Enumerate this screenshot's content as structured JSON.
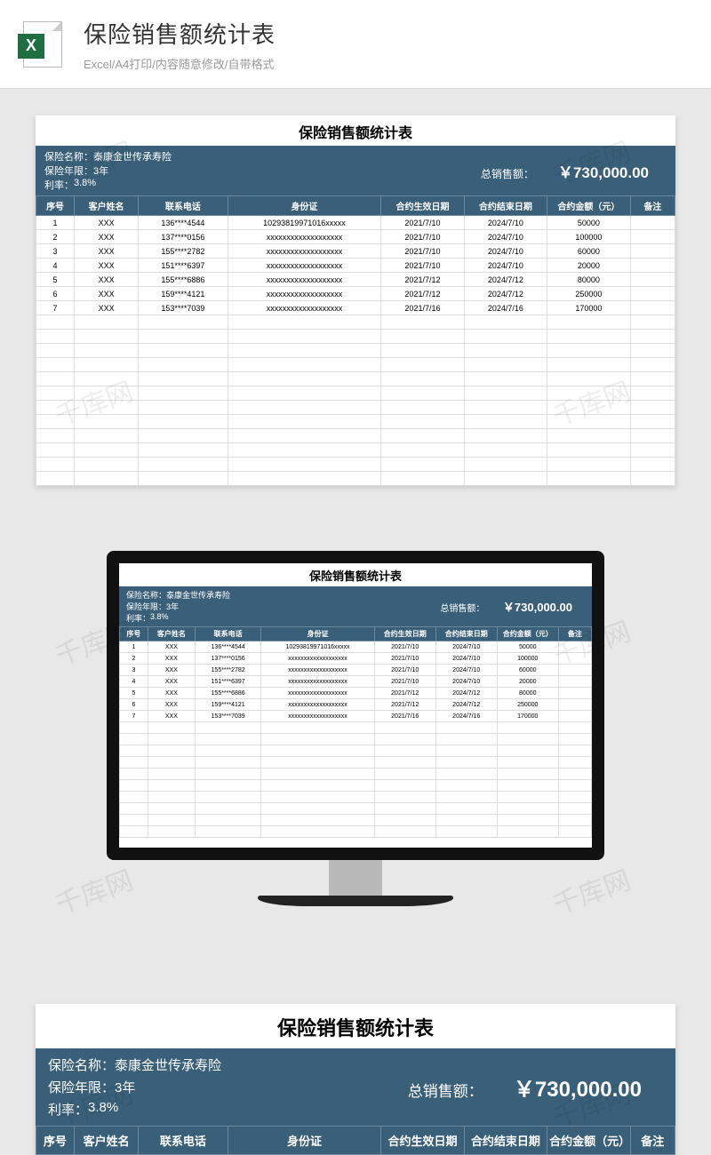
{
  "header": {
    "title": "保险销售额统计表",
    "subtitle": "Excel/A4打印/内容随意修改/自带格式",
    "icon_letter": "X"
  },
  "sheet": {
    "title": "保险销售额统计表",
    "info": {
      "name_label": "保险名称：",
      "name_value": "泰康金世传承寿险",
      "term_label": "保险年限：",
      "term_value": "3年",
      "rate_label": "利率：",
      "rate_value": "3.8%",
      "total_label": "总销售额：",
      "total_value": "￥730,000.00"
    },
    "columns": [
      "序号",
      "客户姓名",
      "联系电话",
      "身份证",
      "合约生效日期",
      "合约结束日期",
      "合约金额（元）",
      "备注"
    ],
    "col_widths": [
      "6%",
      "10%",
      "14%",
      "24%",
      "13%",
      "13%",
      "13%",
      "7%"
    ],
    "rows": [
      {
        "no": "1",
        "name": "XXX",
        "phone": "136****4544",
        "id": "10293819971016xxxxx",
        "start": "2021/7/10",
        "end": "2024/7/10",
        "amount": "50000",
        "note": ""
      },
      {
        "no": "2",
        "name": "XXX",
        "phone": "137****0156",
        "id": "xxxxxxxxxxxxxxxxxxx",
        "start": "2021/7/10",
        "end": "2024/7/10",
        "amount": "100000",
        "note": ""
      },
      {
        "no": "3",
        "name": "XXX",
        "phone": "155****2782",
        "id": "xxxxxxxxxxxxxxxxxxx",
        "start": "2021/7/10",
        "end": "2024/7/10",
        "amount": "60000",
        "note": ""
      },
      {
        "no": "4",
        "name": "XXX",
        "phone": "151****6397",
        "id": "xxxxxxxxxxxxxxxxxxx",
        "start": "2021/7/10",
        "end": "2024/7/10",
        "amount": "20000",
        "note": ""
      },
      {
        "no": "5",
        "name": "XXX",
        "phone": "155****6886",
        "id": "xxxxxxxxxxxxxxxxxxx",
        "start": "2021/7/12",
        "end": "2024/7/12",
        "amount": "80000",
        "note": ""
      },
      {
        "no": "6",
        "name": "XXX",
        "phone": "159****4121",
        "id": "xxxxxxxxxxxxxxxxxxx",
        "start": "2021/7/12",
        "end": "2024/7/12",
        "amount": "250000",
        "note": ""
      },
      {
        "no": "7",
        "name": "XXX",
        "phone": "153****7039",
        "id": "xxxxxxxxxxxxxxxxxxx",
        "start": "2021/7/16",
        "end": "2024/7/16",
        "amount": "170000",
        "note": ""
      }
    ],
    "empty_rows_card1": 12,
    "empty_rows_card2": 10
  },
  "watermark": "千库网"
}
